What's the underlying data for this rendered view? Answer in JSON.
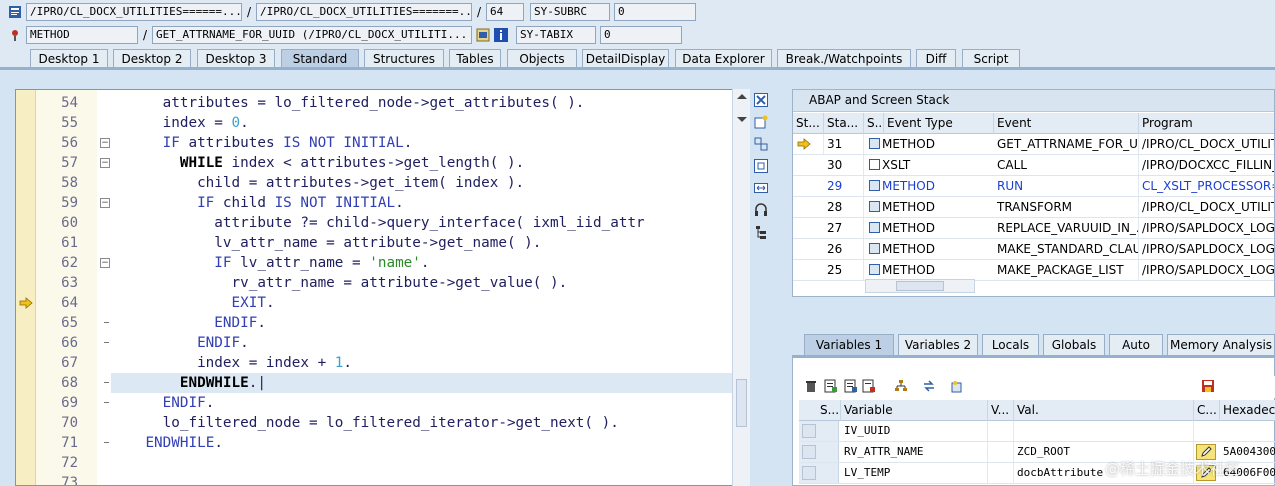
{
  "top": {
    "row1": {
      "program": "/IPRO/CL_DOCX_UTILITIES======...",
      "include": "/IPRO/CL_DOCX_UTILITIES=======...",
      "line": "64",
      "field_name": "SY-SUBRC",
      "field_value": "0"
    },
    "row2": {
      "event_type": "METHOD",
      "event": "GET_ATTRNAME_FOR_UUID (/IPRO/CL_DOCX_UTILITI...",
      "field_name": "SY-TABIX",
      "field_value": "0"
    },
    "separator": "/"
  },
  "tabs": [
    "Desktop 1",
    "Desktop 2",
    "Desktop 3",
    "Standard",
    "Structures",
    "Tables",
    "Objects",
    "DetailDisplay",
    "Data Explorer",
    "Break./Watchpoints",
    "Diff",
    "Script"
  ],
  "active_tab": "Standard",
  "editor": {
    "current_line": "64",
    "lines": [
      {
        "n": "54",
        "text": "      attributes = lo_filtered_node->get_attributes( )."
      },
      {
        "n": "55",
        "text": "      index = 0."
      },
      {
        "n": "56",
        "text": "      IF attributes IS NOT INITIAL."
      },
      {
        "n": "57",
        "text": "        WHILE index < attributes->get_length( )."
      },
      {
        "n": "58",
        "text": "          child = attributes->get_item( index )."
      },
      {
        "n": "59",
        "text": "          IF child IS NOT INITIAL."
      },
      {
        "n": "60",
        "text": "            attribute ?= child->query_interface( ixml_iid_attr"
      },
      {
        "n": "61",
        "text": "            lv_attr_name = attribute->get_name( )."
      },
      {
        "n": "62",
        "text": "            IF lv_attr_name = 'name'."
      },
      {
        "n": "63",
        "text": "              rv_attr_name = attribute->get_value( )."
      },
      {
        "n": "64",
        "text": "              EXIT."
      },
      {
        "n": "65",
        "text": "            ENDIF."
      },
      {
        "n": "66",
        "text": "          ENDIF."
      },
      {
        "n": "67",
        "text": "          index = index + 1."
      },
      {
        "n": "68",
        "text": "        ENDWHILE."
      },
      {
        "n": "69",
        "text": "      ENDIF."
      },
      {
        "n": "70",
        "text": "      lo_filtered_node = lo_filtered_iterator->get_next( )."
      },
      {
        "n": "71",
        "text": "    ENDWHILE."
      },
      {
        "n": "72",
        "text": ""
      },
      {
        "n": "73",
        "text": ""
      }
    ]
  },
  "stack": {
    "title": "ABAP and Screen Stack",
    "headers": [
      "St...",
      "Sta...",
      "S...",
      "Event Type",
      "Event",
      "Program"
    ],
    "rows": [
      {
        "level": "31",
        "type": "METHOD",
        "event": "GET_ATTRNAME_FOR_U...",
        "program": "/IPRO/CL_DOCX_UTILITI",
        "current": true
      },
      {
        "level": "30",
        "type": "XSLT",
        "event": "CALL",
        "program": "/IPRO/DOCXCC_FILLIN_U"
      },
      {
        "level": "29",
        "type": "METHOD",
        "event": "RUN",
        "program": "CL_XSLT_PROCESSOR====",
        "blue": true
      },
      {
        "level": "28",
        "type": "METHOD",
        "event": "TRANSFORM",
        "program": "/IPRO/CL_DOCX_UTILITI"
      },
      {
        "level": "27",
        "type": "METHOD",
        "event": "REPLACE_VARUUID_IN_...",
        "program": "/IPRO/SAPLDOCX_LOGIC"
      },
      {
        "level": "26",
        "type": "METHOD",
        "event": "MAKE_STANDARD_CLAU...",
        "program": "/IPRO/SAPLDOCX_LOGIC"
      },
      {
        "level": "25",
        "type": "METHOD",
        "event": "MAKE_PACKAGE_LIST",
        "program": "/IPRO/SAPLDOCX_LOGIC"
      }
    ]
  },
  "var_tabs": [
    "Variables 1",
    "Variables 2",
    "Locals",
    "Globals",
    "Auto",
    "Memory Analysis"
  ],
  "active_var_tab": "Variables 1",
  "variables": {
    "headers": [
      "S...",
      "Variable",
      "V...",
      "Val.",
      "C...",
      "Hexadecimal"
    ],
    "rows": [
      {
        "name": "IV_UUID",
        "value": "",
        "hex": ""
      },
      {
        "name": "RV_ATTR_NAME",
        "value": "ZCD_ROOT",
        "hex": "5A004300"
      },
      {
        "name": "LV_TEMP",
        "value": "docbAttribute",
        "hex": "64006F00"
      }
    ]
  },
  "watermark": "@稀土掘金技术社区",
  "colors": {
    "accent": "#95b1cd",
    "keyword": "#3240b4",
    "string": "#2a8a2a",
    "number": "#3aa0d0"
  }
}
